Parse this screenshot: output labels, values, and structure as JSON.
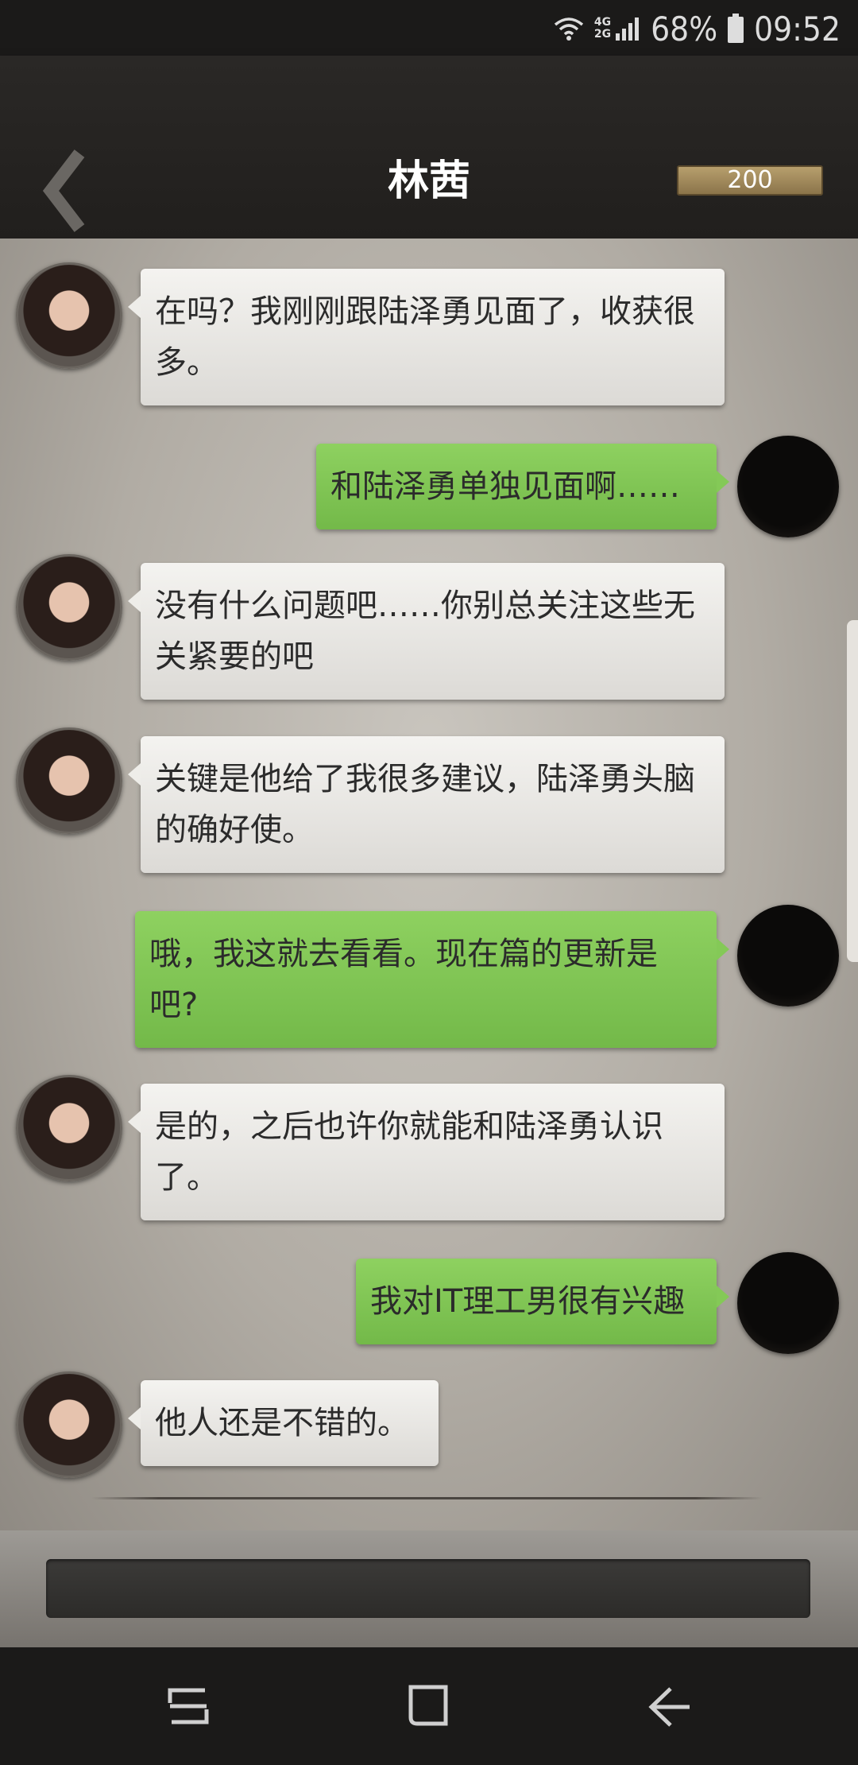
{
  "status_bar": {
    "network_top": "4G",
    "network_bottom": "2G",
    "battery": "68%",
    "time": "09:52"
  },
  "header": {
    "title": "林茜",
    "coins": "200"
  },
  "messages": [
    {
      "side": "in",
      "text": "在吗？我刚刚跟陆泽勇见面了，收获很多。"
    },
    {
      "side": "out",
      "text": "和陆泽勇单独见面啊……"
    },
    {
      "side": "in",
      "text": "没有什么问题吧……你别总关注这些无关紧要的吧"
    },
    {
      "side": "in",
      "text": "关键是他给了我很多建议，陆泽勇头脑的确好使。"
    },
    {
      "side": "out",
      "text": "哦，我这就去看看。现在篇的更新是吧?"
    },
    {
      "side": "in",
      "text": "是的，之后也许你就能和陆泽勇认识了。"
    },
    {
      "side": "out",
      "text": "我对IT理工男很有兴趣"
    },
    {
      "side": "in",
      "text": "他人还是不错的。"
    }
  ],
  "icons": {
    "back": "chevron-left-icon",
    "wifi": "wifi-icon",
    "signal": "signal-icon",
    "battery": "battery-icon",
    "nav_recent": "recent-apps-icon",
    "nav_home": "home-icon",
    "nav_back": "back-arrow-icon"
  },
  "colors": {
    "outgoing_bubble": "#84c957",
    "incoming_bubble": "#eeede9",
    "header_bg": "#262422",
    "coin_box": "#a38d5e"
  }
}
